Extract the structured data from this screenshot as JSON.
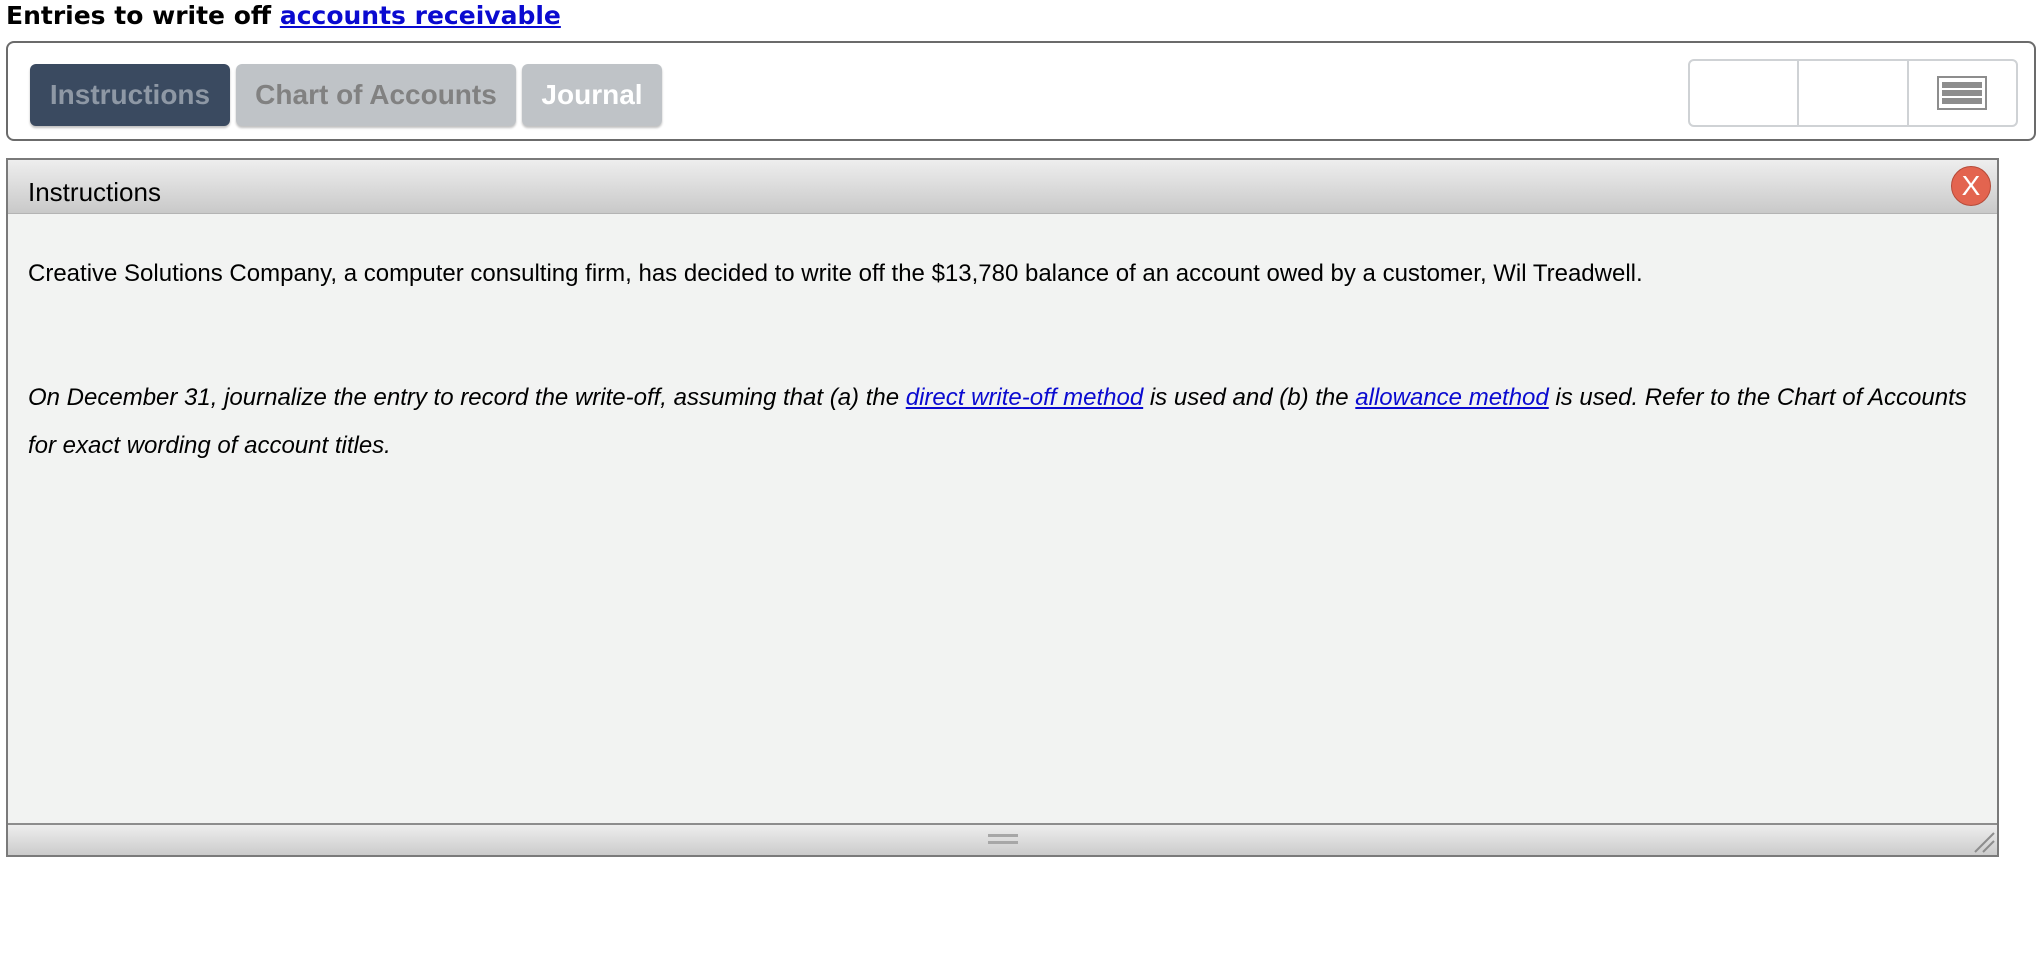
{
  "page": {
    "title_prefix": "Entries to write off ",
    "title_link": "accounts receivable"
  },
  "tabs": [
    {
      "label": "Instructions",
      "active": true
    },
    {
      "label": "Chart of Accounts",
      "active": false
    },
    {
      "label": "Journal",
      "active": false
    }
  ],
  "tools": {
    "icons": [
      "blank-tool-icon",
      "blank-tool-icon",
      "menu-icon"
    ]
  },
  "panel": {
    "title": "Instructions",
    "close_label": "X",
    "paragraph1": "Creative Solutions Company, a computer consulting firm, has decided to write off the $13,780 balance of an account owed by a customer, Wil Treadwell.",
    "paragraph2": {
      "part1": "On December 31, journalize the entry to record the write-off, assuming that (a) the ",
      "link1": "direct write-off method",
      "part2": " is used and (b) the ",
      "link2": "allowance method",
      "part3": " is used. Refer to the Chart of Accounts for exact wording of account titles."
    }
  },
  "colors": {
    "active_tab": "#3a4a60",
    "inactive_tab": "#bfc3c7",
    "link": "#0a0ad0",
    "close_button": "#e3644f",
    "panel_background": "#f2f3f2"
  }
}
